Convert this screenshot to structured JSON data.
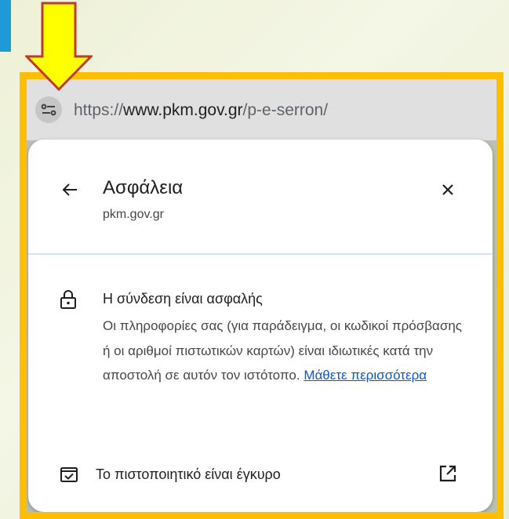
{
  "url_bar": {
    "url_scheme": "https://",
    "url_domain": "www.pkm.gov.gr",
    "url_path": "/p-e-serron/",
    "tune_icon": "tune-icon"
  },
  "popup": {
    "title": "Ασφάλεια",
    "subtitle": "pkm.gov.gr",
    "back_icon": "arrow-back-icon",
    "close_icon": "close-icon",
    "connection": {
      "icon": "lock-icon",
      "title": "Η σύνδεση είναι ασφαλής",
      "description": "Οι πληροφορίες σας (για παράδειγμα, οι κωδικοί πρόσβασης ή οι αριθμοί πιστωτικών καρτών) είναι ιδιωτικές κατά την αποστολή σε αυτόν τον ιστότοπο.",
      "learn_more": "Μάθετε περισσότερα"
    },
    "certificate": {
      "icon": "certificate-icon",
      "label": "Το πιστοποιητικό είναι έγκυρο",
      "external_icon": "open-in-new-icon"
    }
  },
  "annotation": {
    "arrow_icon": "down-arrow-icon",
    "arrow_color": "#ffff00",
    "frame_color": "#ffbe00",
    "accent_color": "#1e9ad6"
  }
}
